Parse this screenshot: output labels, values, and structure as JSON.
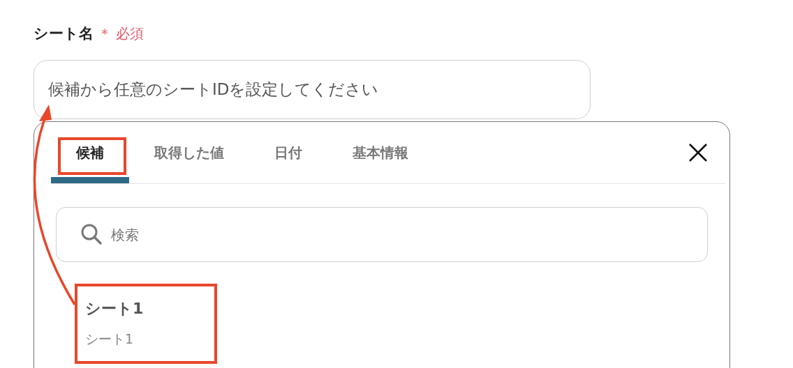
{
  "field": {
    "label": "シート名",
    "required_mark": "＊",
    "required_text": "必須",
    "value": "候補から任意のシートIDを設定してください"
  },
  "picker": {
    "tabs": [
      {
        "label": "候補",
        "selected": true
      },
      {
        "label": "取得した値",
        "selected": false
      },
      {
        "label": "日付",
        "selected": false
      },
      {
        "label": "基本情報",
        "selected": false
      }
    ],
    "search": {
      "placeholder": "検索"
    },
    "items": [
      {
        "title": "シート1",
        "subtitle": "シート1"
      }
    ]
  }
}
